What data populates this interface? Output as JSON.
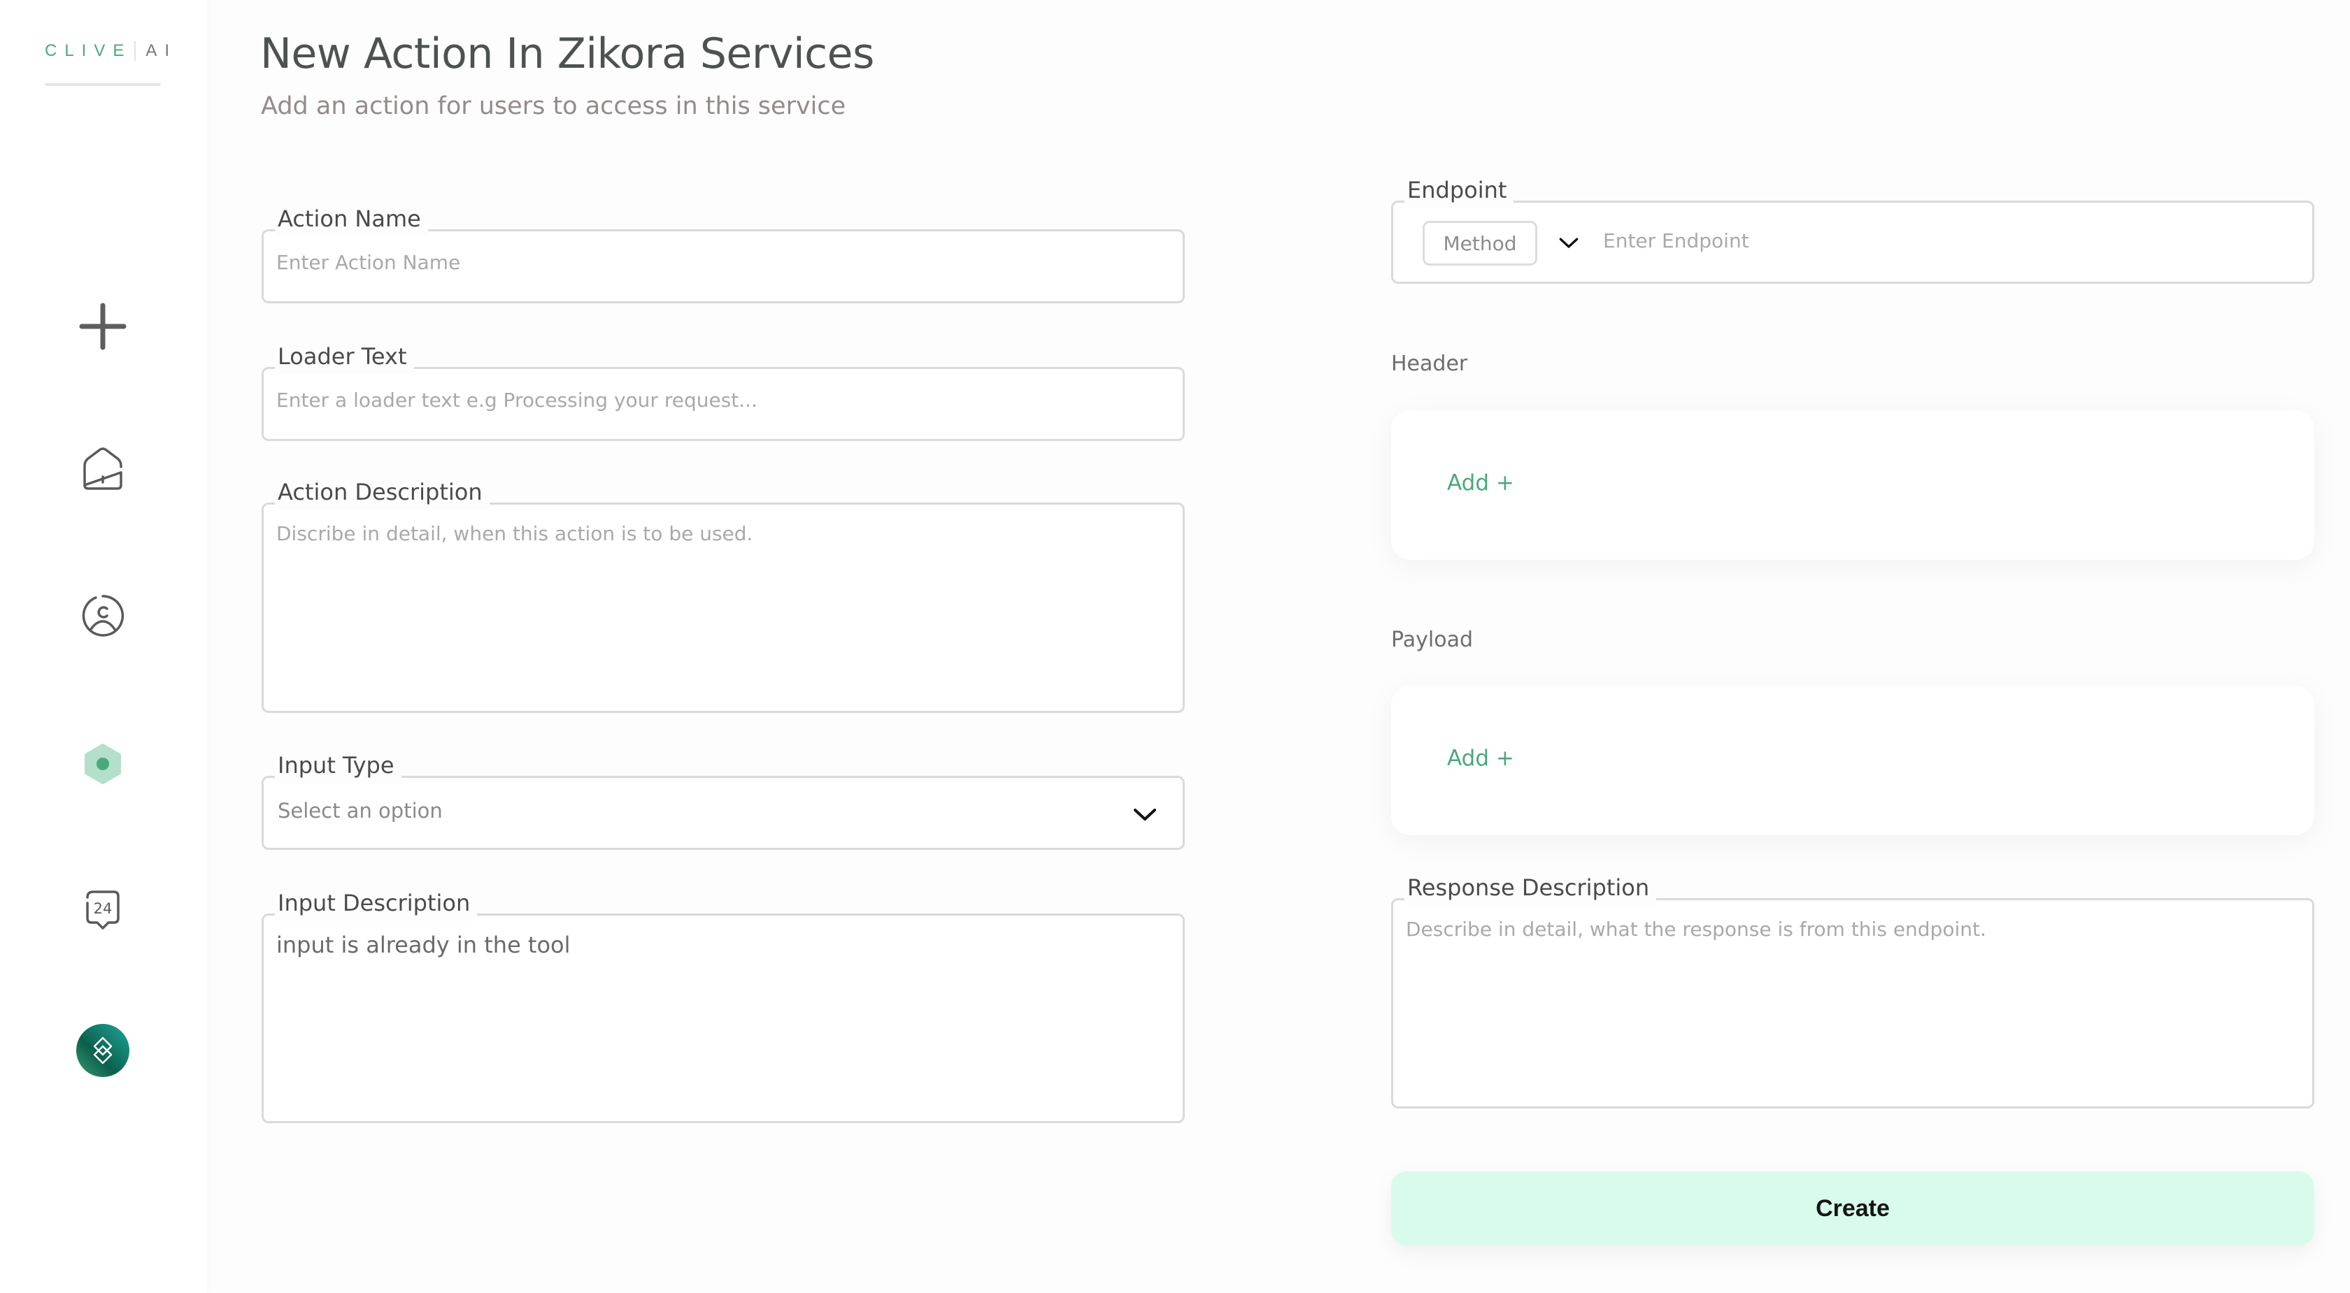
{
  "brand": {
    "name": "CLIVE",
    "suffix": "AI",
    "accent": "#4aa97c"
  },
  "sidebar": {
    "items": [
      {
        "icon": "plus-icon",
        "label": "New"
      },
      {
        "icon": "home-icon",
        "label": "Home"
      },
      {
        "icon": "user-icon",
        "label": "Profile"
      },
      {
        "icon": "hexagon-icon",
        "label": "Services",
        "active": true
      },
      {
        "icon": "support-24-icon",
        "label": "24"
      },
      {
        "icon": "avatar-logo-icon",
        "label": "Account"
      }
    ]
  },
  "header": {
    "title": "New Action In Zikora Services",
    "subtitle": "Add an action for users to access in this service"
  },
  "form": {
    "action_name": {
      "label": "Action Name",
      "placeholder": "Enter Action Name",
      "value": ""
    },
    "loader_text": {
      "label": "Loader Text",
      "placeholder": "Enter a loader text e.g Processing your request...",
      "value": ""
    },
    "action_description": {
      "label": "Action Description",
      "placeholder": "Discribe in detail, when this action is to be used.",
      "value": ""
    },
    "input_type": {
      "label": "Input Type",
      "selected": "Select an option"
    },
    "input_description": {
      "label": "Input Description",
      "value": "input is already in the tool"
    },
    "endpoint": {
      "label": "Endpoint",
      "method": "Method",
      "placeholder": "Enter Endpoint",
      "value": ""
    },
    "header": {
      "label": "Header",
      "add_label": "Add +"
    },
    "payload": {
      "label": "Payload",
      "add_label": "Add +"
    },
    "response_description": {
      "label": "Response Description",
      "placeholder": "Describe in detail, what the response is from this endpoint.",
      "value": ""
    },
    "create_label": "Create"
  }
}
